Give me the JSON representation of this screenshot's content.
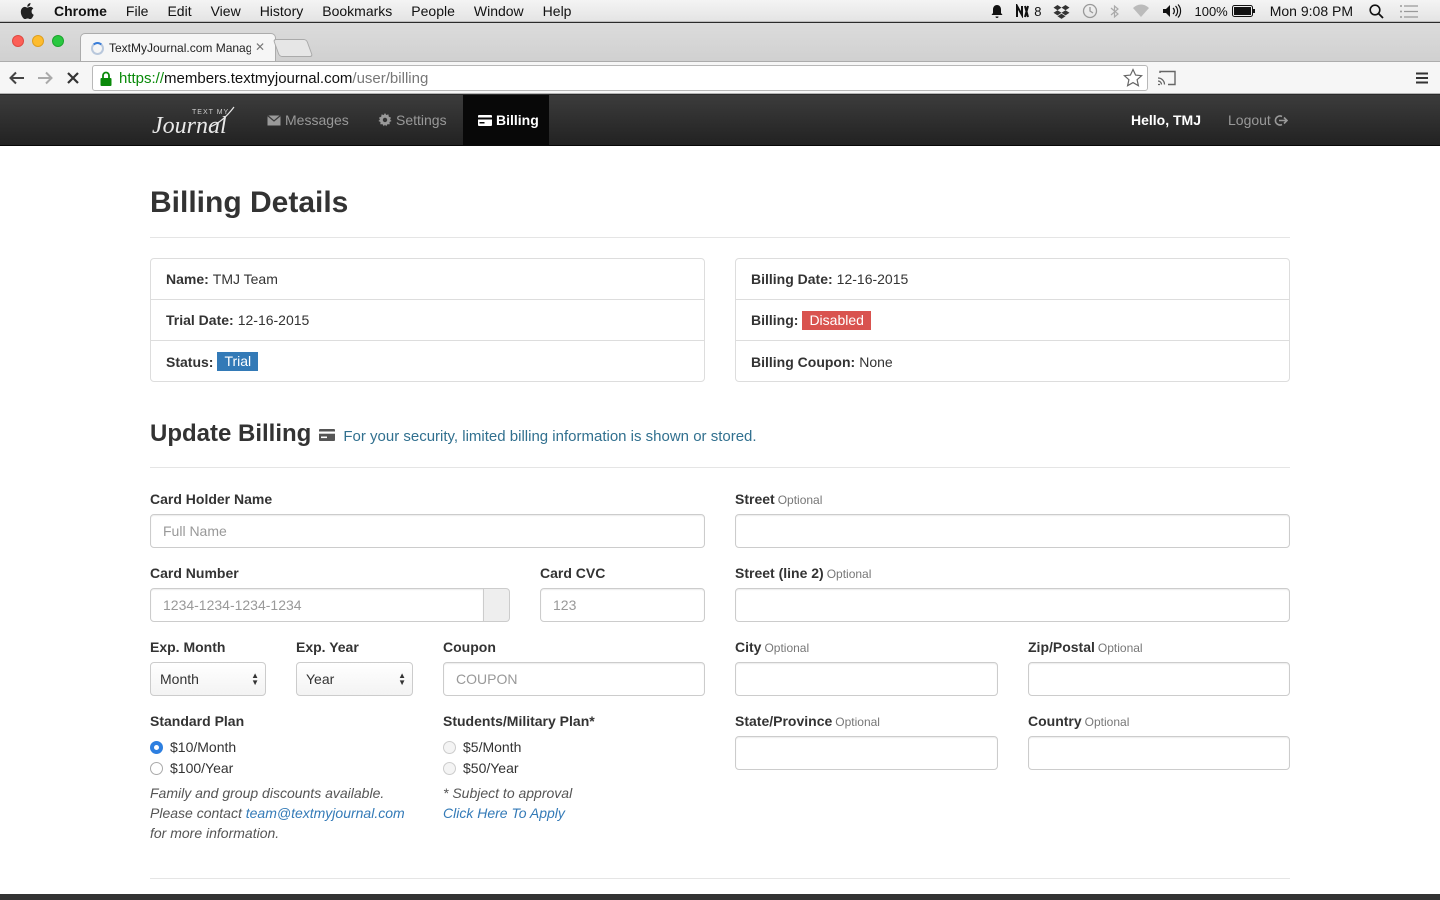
{
  "menubar": {
    "app": "Chrome",
    "items": [
      "File",
      "Edit",
      "View",
      "History",
      "Bookmarks",
      "People",
      "Window",
      "Help"
    ],
    "notifications_count": "8",
    "battery": "100%",
    "clock": "Mon 9:08 PM"
  },
  "browser": {
    "tab_title": "TextMyJournal.com Manag",
    "url_scheme": "https://",
    "url_domain": "members.textmyjournal.com",
    "url_path": "/user/billing"
  },
  "navbar": {
    "brand_top": "TEXT MY",
    "brand_main": "Journal",
    "items": [
      {
        "label": "Messages",
        "icon": "envelope-icon"
      },
      {
        "label": "Settings",
        "icon": "gear-icon"
      },
      {
        "label": "Billing",
        "icon": "credit-card-icon",
        "active": true
      }
    ],
    "hello": "Hello, TMJ",
    "logout": "Logout"
  },
  "page": {
    "title": "Billing Details",
    "left_panel": {
      "name_label": "Name:",
      "name_value": "TMJ Team",
      "trial_label": "Trial Date:",
      "trial_value": "12-16-2015",
      "status_label": "Status:",
      "status_value": "Trial"
    },
    "right_panel": {
      "billing_date_label": "Billing Date:",
      "billing_date_value": "12-16-2015",
      "billing_label": "Billing:",
      "billing_value": "Disabled",
      "coupon_label": "Billing Coupon:",
      "coupon_value": "None"
    },
    "update_title": "Update Billing",
    "security_note": "For your security, limited billing information is shown or stored.",
    "form": {
      "card_holder_label": "Card Holder Name",
      "card_holder_placeholder": "Full Name",
      "card_number_label": "Card Number",
      "card_number_placeholder": "1234-1234-1234-1234",
      "card_cvc_label": "Card CVC",
      "card_cvc_placeholder": "123",
      "exp_month_label": "Exp. Month",
      "exp_month_value": "Month",
      "exp_year_label": "Exp. Year",
      "exp_year_value": "Year",
      "coupon_label": "Coupon",
      "coupon_placeholder": "COUPON",
      "street_label": "Street",
      "street2_label": "Street (line 2)",
      "city_label": "City",
      "zip_label": "Zip/Postal",
      "state_label": "State/Province",
      "country_label": "Country",
      "optional": "Optional"
    },
    "standard_plan": {
      "label": "Standard Plan",
      "options": [
        "$10/Month",
        "$100/Year"
      ],
      "selected": "$10/Month",
      "note_line1": "Family and group discounts available.",
      "note_line2_prefix": "Please contact ",
      "note_email": "team@textmyjournal.com",
      "note_line3": "for more information."
    },
    "student_plan": {
      "label": "Students/Military Plan*",
      "options": [
        "$5/Month",
        "$50/Year"
      ],
      "note": "* Subject to approval",
      "apply_link": "Click Here To Apply"
    }
  }
}
